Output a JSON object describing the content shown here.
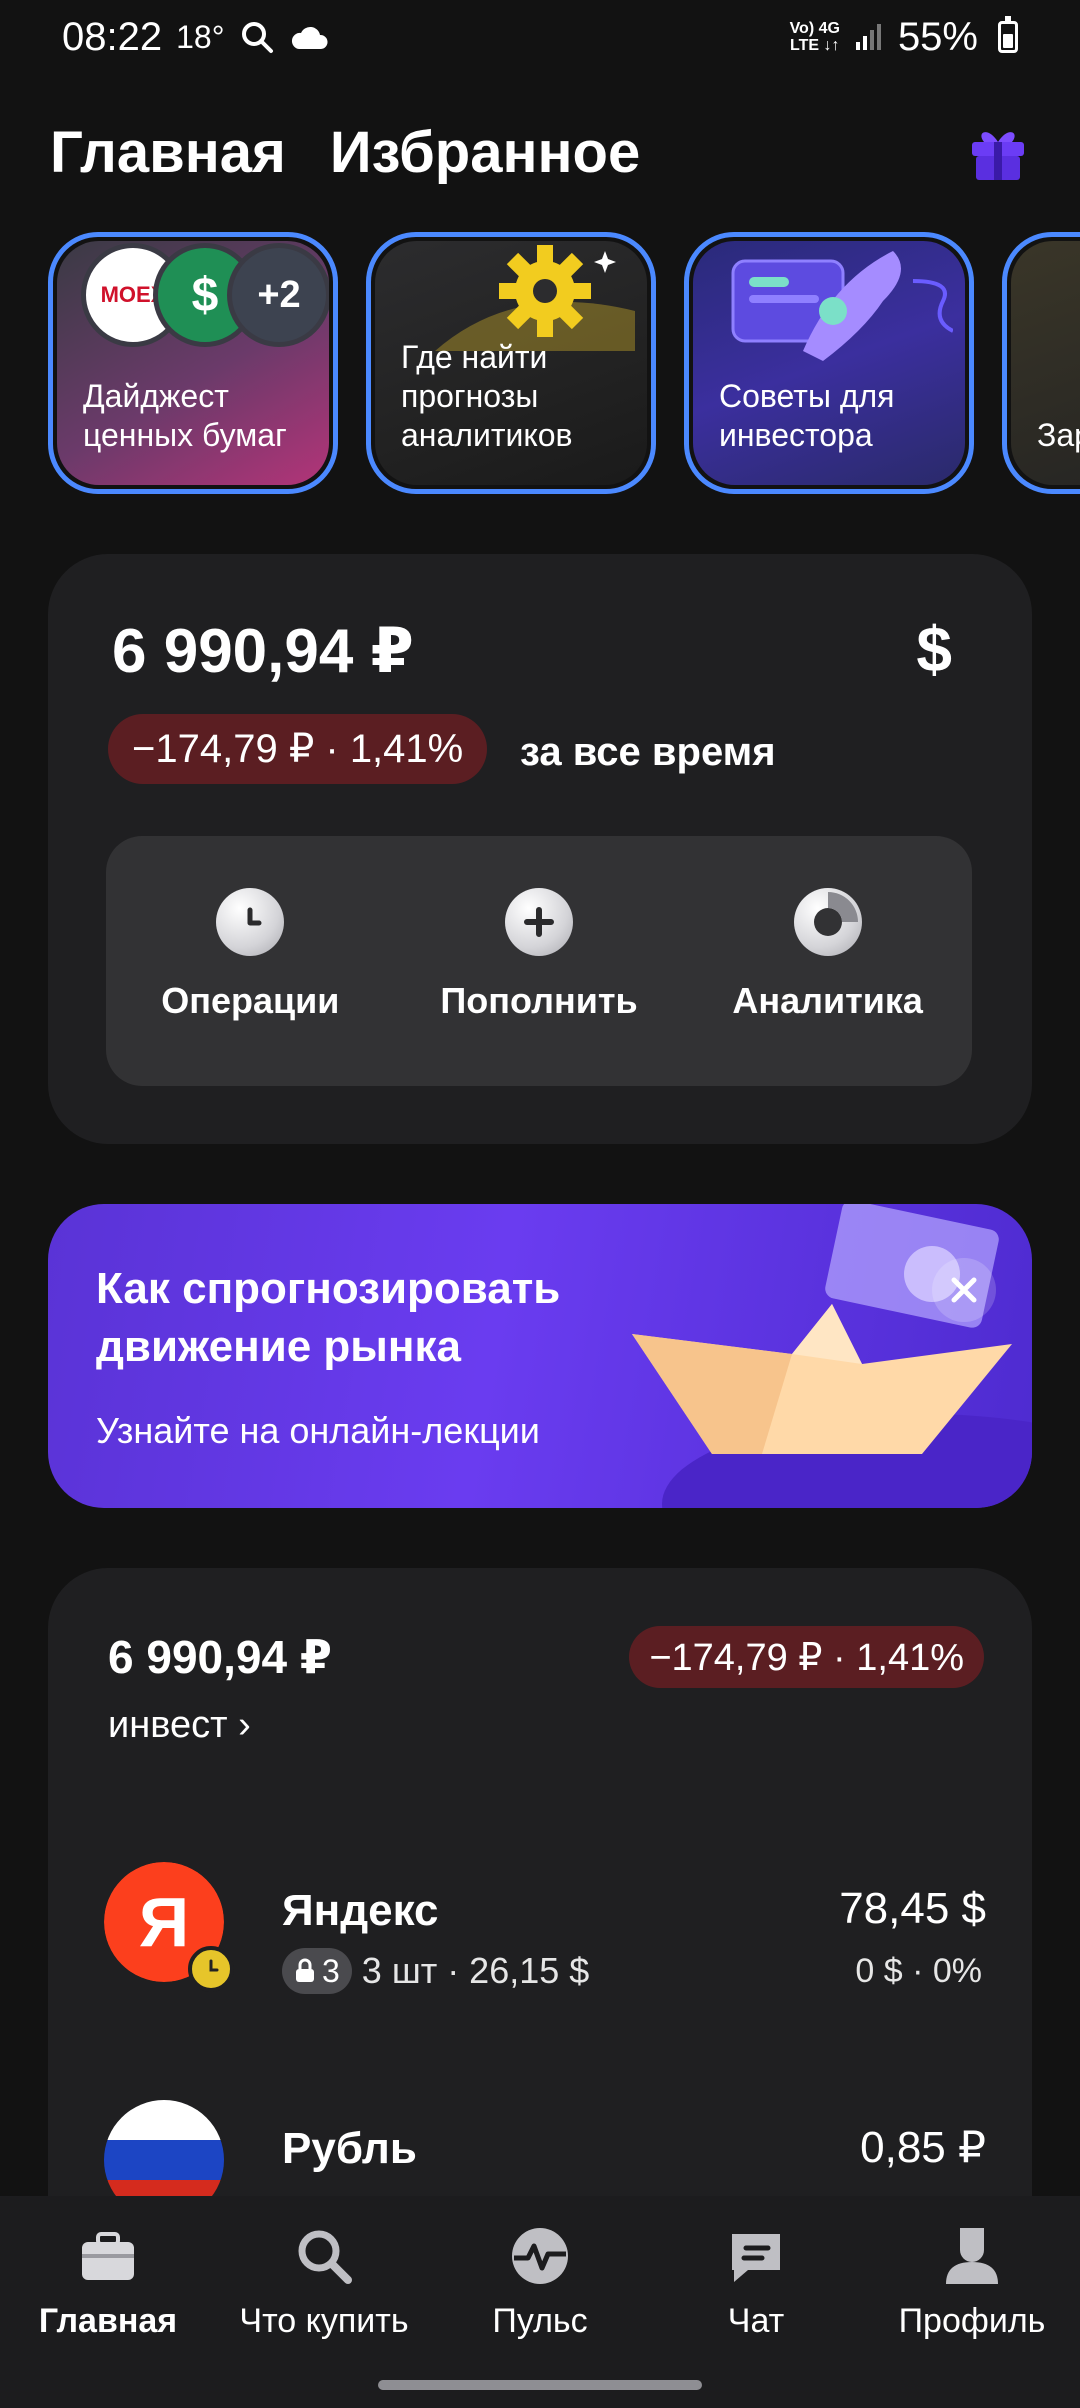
{
  "status_bar": {
    "time": "08:22",
    "temperature": "18°",
    "network_top": "Vo) 4G",
    "network_bottom": "LTE ↓↑",
    "battery": "55%"
  },
  "header": {
    "tabs": [
      "Главная",
      "Избранное"
    ],
    "gift_icon": "gift-icon",
    "accent": "#6b3cf5"
  },
  "stories": [
    {
      "title": "Дайджест ценных бумаг",
      "badges": [
        "MOEX",
        "$",
        "+2"
      ]
    },
    {
      "title": "Где найти прогнозы аналитиков"
    },
    {
      "title": "Советы для инвестора"
    },
    {
      "title": "Зар на акц"
    }
  ],
  "portfolio": {
    "total": "6 990,94 ₽",
    "currency_toggle": "$",
    "change": "−174,79 ₽ · 1,41%",
    "change_period": "за все время",
    "actions": [
      {
        "label": "Операции",
        "icon": "clock-icon"
      },
      {
        "label": "Пополнить",
        "icon": "plus-icon"
      },
      {
        "label": "Аналитика",
        "icon": "donut-chart-icon"
      }
    ]
  },
  "promo": {
    "title_line1": "Как спрогнозировать",
    "title_line2": "движение рынка",
    "subtitle": "Узнайте на онлайн-лекции",
    "close_icon": "close-icon"
  },
  "account": {
    "total": "6 990,94 ₽",
    "change": "−174,79 ₽ · 1,41%",
    "name": "инвест ›",
    "assets": [
      {
        "name": "Яндекс",
        "lock_count": "3",
        "details": "3 шт · 26,15 $",
        "value": "78,45 $",
        "yield": "0 $ · 0%"
      },
      {
        "name": "Рубль",
        "value": "0,85 ₽"
      }
    ]
  },
  "bottom_nav": [
    {
      "label": "Главная",
      "icon": "briefcase-icon",
      "active": true
    },
    {
      "label": "Что купить",
      "icon": "search-icon"
    },
    {
      "label": "Пульс",
      "icon": "pulse-icon"
    },
    {
      "label": "Чат",
      "icon": "chat-icon"
    },
    {
      "label": "Профиль",
      "icon": "profile-icon"
    }
  ],
  "colors": {
    "background": "#121212",
    "card": "#1f1f21",
    "negative_pill": "#5b1e22",
    "story_border": "#4b89ff",
    "promo": "#6a3cf0",
    "yandex_red": "#fc3f1d"
  }
}
